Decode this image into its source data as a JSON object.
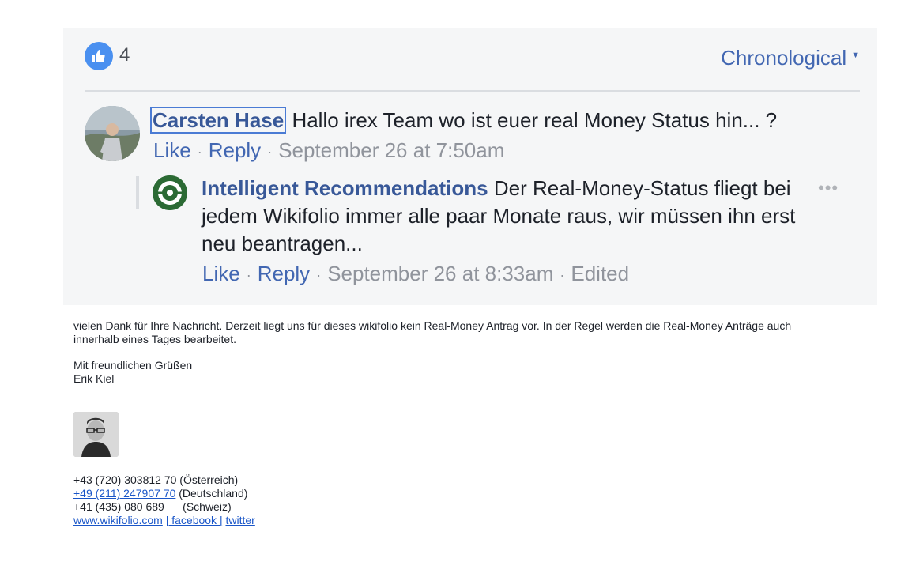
{
  "fb": {
    "like_count": "4",
    "sort_label": "Chronological",
    "comments": [
      {
        "author": "Carsten Hase",
        "text": "Hallo irex Team wo ist euer real Money Status hin... ?",
        "like": "Like",
        "reply": "Reply",
        "time": "September 26 at 7:50am"
      },
      {
        "author": "Intelligent Recommendations",
        "text": "Der Real-Money-Status fliegt bei jedem Wikifolio immer alle paar Monate raus, wir müssen ihn erst neu beantragen...",
        "like": "Like",
        "reply": "Reply",
        "time": "September 26 at 8:33am",
        "edited": "Edited"
      }
    ],
    "more_options": "•••"
  },
  "email": {
    "paragraph1": "vielen Dank für Ihre Nachricht. Derzeit liegt uns für dieses wikifolio kein Real-Money Antrag vor. In der Regel werden die Real-Money Anträge auch innerhalb eines Tages bearbeitet.",
    "greeting": "Mit freundlichen Grüßen",
    "signer": "Erik Kiel",
    "phone_at": "+43 (720) 303812 70 (Österreich)",
    "phone_de": "+49 (211) 247907 70",
    "phone_de_label": " (Deutschland)",
    "phone_ch": "+41 (435) 080 689      (Schweiz)",
    "website": "www.wikifolio.com",
    "facebook": "| facebook |",
    "twitter": "twitter"
  },
  "colors": {
    "fb_blue": "#4267b2",
    "like_blue": "#4a90f0",
    "panel_bg": "#f5f6f7"
  },
  "icons": {
    "like": "thumbs-up-icon",
    "sort": "caret-down-icon",
    "more": "more-dots-icon"
  }
}
